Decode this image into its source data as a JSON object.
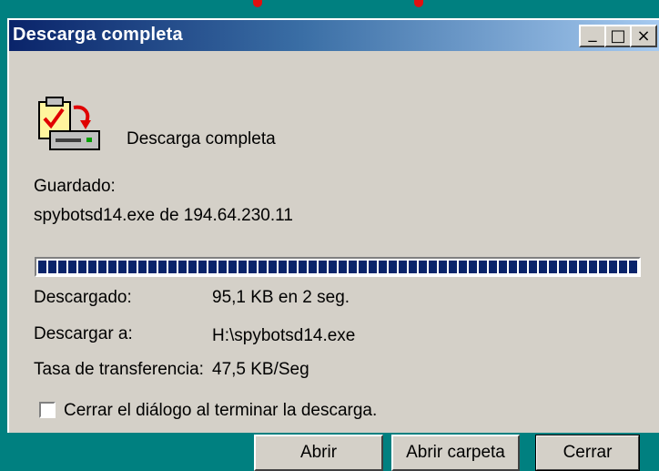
{
  "window": {
    "title": "Descarga completa",
    "controls": {
      "minimize": "_",
      "maximize": "□",
      "close": "×"
    }
  },
  "status": {
    "message": "Descarga completa"
  },
  "saved": {
    "label": "Guardado:",
    "source": "spybotsd14.exe de 194.64.230.11"
  },
  "progress": {
    "percent": 100
  },
  "details": [
    {
      "label": "Descargado:",
      "value": "95,1 KB en 2 seg."
    },
    {
      "label": "Descargar a:",
      "value": "H:\\spybotsd14.exe"
    },
    {
      "label": "Tasa de transferencia:",
      "value": "47,5 KB/Seg"
    }
  ],
  "close_on_finish": {
    "label": "Cerrar el diálogo al terminar la descarga.",
    "checked": false
  },
  "buttons": {
    "open": "Abrir",
    "open_folder": "Abrir carpeta",
    "close": "Cerrar"
  },
  "icons": {
    "app": "download-complete-icon"
  },
  "colors": {
    "titlebar_start": "#0a246a",
    "titlebar_end": "#a6caf0",
    "progress": "#0a246a",
    "desktop": "#008080"
  }
}
